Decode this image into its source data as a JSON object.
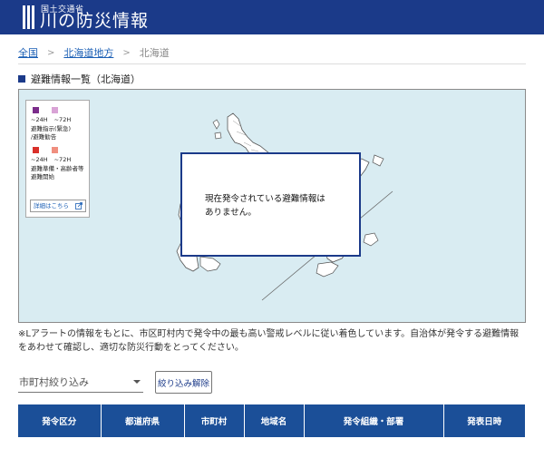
{
  "header": {
    "sub_title": "国土交通省",
    "site_title": "川の防災情報"
  },
  "breadcrumb": {
    "items": [
      "全国",
      "北海道地方"
    ],
    "separator": ">",
    "current": "北海道"
  },
  "section": {
    "title": "避難情報一覧（北海道）"
  },
  "legend": {
    "label_24h": "~24H",
    "label_72h": "~72H",
    "group1_text": [
      "避難指示(緊急)",
      "/避難勧告"
    ],
    "group2_text": [
      "避難準備・高齢者等",
      "避難開始"
    ],
    "details_link": "詳細はこちら",
    "details_link_icon": "external-link-icon",
    "colors": {
      "group1_24h": "#7b2d8b",
      "group1_72h": "#d9a3d6",
      "group2_24h": "#d9302a",
      "group2_72h": "#f08f7f"
    }
  },
  "notice": {
    "line1": "現在発令されている避難情報は",
    "line2": "ありません。"
  },
  "note": {
    "text": "※Lアラートの情報をもとに、市区町村内で発令中の最も高い警戒レベルに従い着色しています。自治体が発令する避難情報をあわせて確認し、適切な防災行動をとってください。"
  },
  "filter": {
    "placeholder": "市町村絞り込み",
    "clear_label": "絞り込み解除"
  },
  "table": {
    "headers": [
      "発令区分",
      "都道府県",
      "市町村",
      "地域名",
      "発令組織・部署",
      "発表日時"
    ]
  },
  "colors": {
    "header_bg": "#1b3a89",
    "table_header_bg": "#1b4f98",
    "map_sea": "#d9ecf2",
    "link": "#1b5fb5"
  }
}
